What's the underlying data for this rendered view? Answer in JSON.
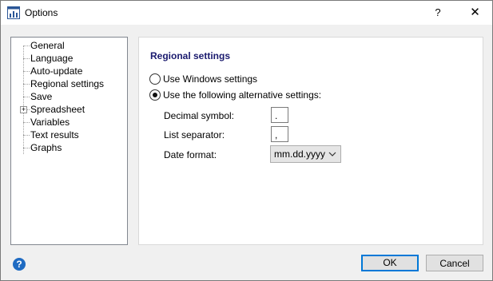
{
  "window": {
    "title": "Options",
    "help_label": "?",
    "close_label": "✕"
  },
  "tree": {
    "items": [
      {
        "label": "General",
        "expandable": false
      },
      {
        "label": "Language",
        "expandable": false
      },
      {
        "label": "Auto-update",
        "expandable": false
      },
      {
        "label": "Regional settings",
        "expandable": false
      },
      {
        "label": "Save",
        "expandable": false
      },
      {
        "label": "Spreadsheet",
        "expandable": true
      },
      {
        "label": "Variables",
        "expandable": false
      },
      {
        "label": "Text results",
        "expandable": false
      },
      {
        "label": "Graphs",
        "expandable": false
      }
    ],
    "expander_label": "+"
  },
  "regional": {
    "title": "Regional settings",
    "option_windows": "Use Windows settings",
    "option_alternative": "Use the following alternative settings:",
    "selected_option": "alternative",
    "decimal_label": "Decimal symbol:",
    "decimal_value": ".",
    "list_sep_label": "List separator:",
    "list_sep_value": ",",
    "date_label": "Date format:",
    "date_value": "mm.dd.yyyy"
  },
  "footer": {
    "help_icon": "?",
    "ok_label": "OK",
    "cancel_label": "Cancel"
  },
  "colors": {
    "section_title": "#1a1a6e",
    "default_button_border": "#0078d7",
    "help_icon_bg": "#1f6bc2"
  }
}
